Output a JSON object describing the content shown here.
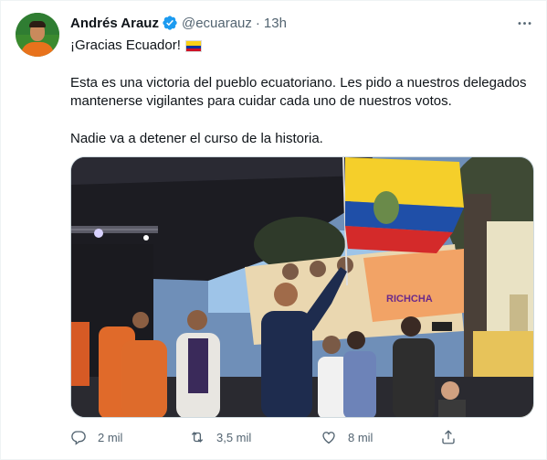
{
  "tweet": {
    "author_name": "Andrés Arauz",
    "author_handle": "@ecuarauz",
    "separator": "·",
    "time": "13h",
    "more_label": "···",
    "line1": "¡Gracias Ecuador!",
    "line2": "Esta es una victoria del pueblo ecuatoriano. Les pido a nuestros delegados mantenerse vigilantes para cuidar cada uno de nuestros votos.",
    "line3": "Nadie va a detener el curso de la historia.",
    "banner_text": "RICHCHA"
  },
  "actions": {
    "reply_count": "2 mil",
    "retweet_count": "3,5 mil",
    "like_count": "8 mil"
  },
  "icons": {
    "verified": "verified-badge-icon",
    "more": "ellipsis-icon",
    "reply": "reply-icon",
    "retweet": "retweet-icon",
    "like": "heart-icon",
    "share": "share-icon",
    "flag": "ecuador-flag-emoji"
  },
  "colors": {
    "text": "#0f1419",
    "secondary": "#536471",
    "verified": "#1d9bf0"
  }
}
